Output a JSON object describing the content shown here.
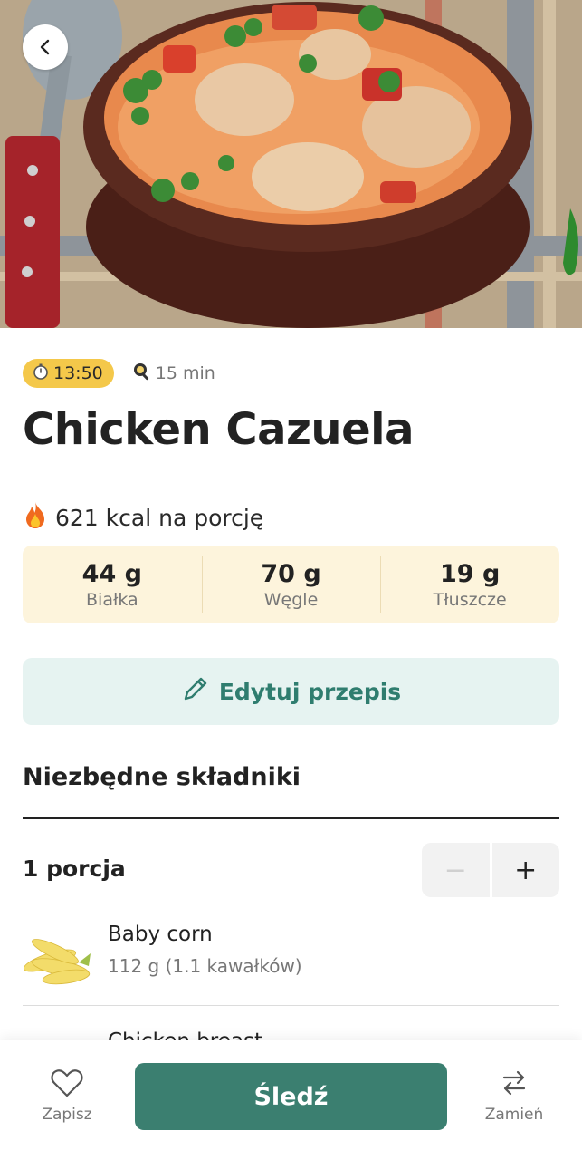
{
  "recipe": {
    "time_badge": "13:50",
    "duration": "15 min",
    "title": "Chicken Cazuela",
    "kcal_text": "621 kcal na porcję"
  },
  "macros": [
    {
      "value": "44 g",
      "label": "Białka"
    },
    {
      "value": "70 g",
      "label": "Węgle"
    },
    {
      "value": "19 g",
      "label": "Tłuszcze"
    }
  ],
  "actions": {
    "edit_label": "Edytuj przepis"
  },
  "ingredients_section": {
    "title": "Niezbędne składniki",
    "portion_label": "1 porcja",
    "minus": "−",
    "plus": "+",
    "items": [
      {
        "name": "Baby corn",
        "quantity": "112 g (1.1 kawałków)",
        "icon": "baby-corn-image"
      },
      {
        "name": "Chicken breast",
        "icon": "chicken-breast-image"
      }
    ]
  },
  "bottom_bar": {
    "save_label": "Zapisz",
    "track_label": "Śledź",
    "swap_label": "Zamień"
  },
  "colors": {
    "accent_green": "#3b7f70",
    "time_pill_yellow": "#f4c84a",
    "macro_bg": "#fdf4dc",
    "edit_bg": "#e6f3f1"
  }
}
